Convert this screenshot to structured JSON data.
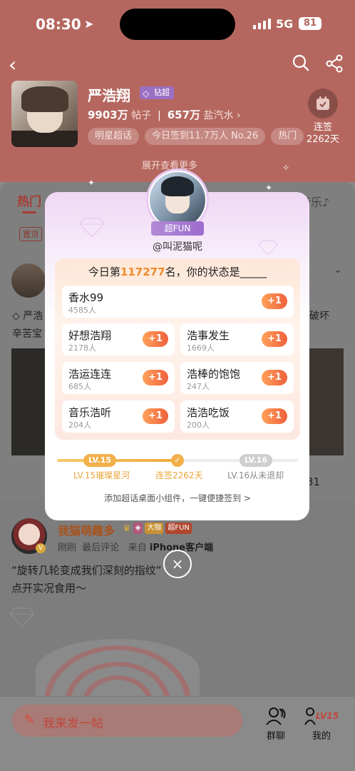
{
  "status_bar": {
    "time": "08:30",
    "network": "5G",
    "battery": "81"
  },
  "header": {
    "name": "严浩翔",
    "badge": "钻超",
    "posts_count": "9903万",
    "posts_label": "帖子",
    "fans_count": "657万",
    "fans_label": "盐汽水",
    "tags": [
      "明星超话",
      "今日签到11.7万人 No.26",
      "热门"
    ],
    "checkin_label": "连签",
    "checkin_days": "2262天",
    "expand_text": "展开查看更多"
  },
  "background_feed": {
    "tab_hot": "热门",
    "tab_music": "音乐♪",
    "pin_tag": "置顶",
    "fragment_left_1": "严浩",
    "fragment_left_2": "辛苦宝",
    "fragment_right_1": "破坏",
    "fragment_right_2": "31",
    "post_user": "我猫萌趣多",
    "badge_big": "大咖",
    "badge_fun": "超FUN",
    "meta_time": "刚刚",
    "meta_comment": "最后评论",
    "meta_from": "来自",
    "meta_device": "iPhone客户端",
    "post_line_1": "“旋转几轮变成我们深刻的指纹”",
    "post_line_2": "点开实况食用～"
  },
  "bottom_bar": {
    "compose_placeholder": "我来发一帖",
    "group_chat": "群聊",
    "mine": "我的",
    "level_tag": "LV15"
  },
  "modal": {
    "super_fun": "超FUN",
    "handle": "@叫泥猫呢",
    "title_prefix": "今日第",
    "rank": "117277",
    "title_suffix": "名，你的状态是_____",
    "options": [
      {
        "name": "香水99",
        "count": "4585人",
        "action": "+1"
      },
      {
        "name": "好想浩翔",
        "count": "2178人",
        "action": "+1"
      },
      {
        "name": "浩事发生",
        "count": "1669人",
        "action": "+1"
      },
      {
        "name": "浩运连连",
        "count": "685人",
        "action": "+1"
      },
      {
        "name": "浩棒的饱饱",
        "count": "247人",
        "action": "+1"
      },
      {
        "name": "音乐浩听",
        "count": "204人",
        "action": "+1"
      },
      {
        "name": "浩浩吃饭",
        "count": "200人",
        "action": "+1"
      }
    ],
    "level_current": "LV.15",
    "level_next": "LV.16",
    "level_current_label": "LV.15璀璨星河",
    "streak_label": "连签2262天",
    "level_next_label": "LV.16从未退却",
    "progress_fraction": 0.5,
    "widget_link": "添加超话桌面小组件，一键便捷签到 >",
    "close_label": "×"
  },
  "colors": {
    "accent": "#f0613c",
    "level": "#f2b04b",
    "brand_red": "#c2463b"
  }
}
